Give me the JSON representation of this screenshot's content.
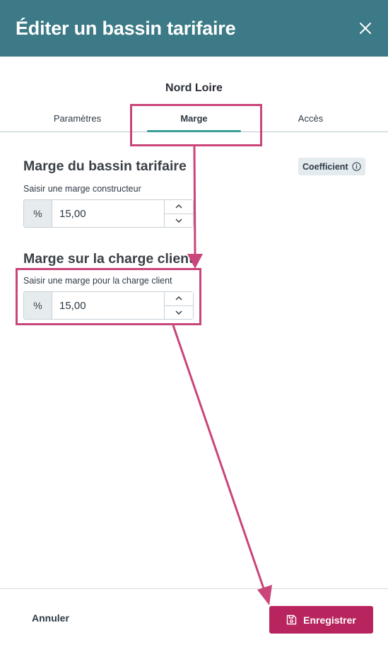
{
  "header": {
    "title": "Éditer un bassin tarifaire"
  },
  "page": {
    "subtitle": "Nord Loire"
  },
  "tabs": [
    {
      "label": "Paramètres",
      "active": false
    },
    {
      "label": "Marge",
      "active": true
    },
    {
      "label": "Accès",
      "active": false
    }
  ],
  "section1": {
    "title": "Marge du bassin tarifaire",
    "badge": "Coefficient",
    "field_label": "Saisir une marge constructeur",
    "prefix": "%",
    "value": "15,00"
  },
  "section2": {
    "title": "Marge sur la charge client",
    "field_label": "Saisir une marge pour la charge client",
    "prefix": "%",
    "value": "15,00"
  },
  "footer": {
    "cancel_label": "Annuler",
    "save_label": "Enregistrer"
  },
  "colors": {
    "header_bg": "#3b7a86",
    "accent_tab": "#3b9e96",
    "save_button": "#b8245e",
    "annotation": "#c9457a"
  },
  "icons": {
    "close": "close-icon",
    "info": "info-icon",
    "save": "save-icon",
    "chevron_up": "chevron-up-icon",
    "chevron_down": "chevron-down-icon"
  }
}
